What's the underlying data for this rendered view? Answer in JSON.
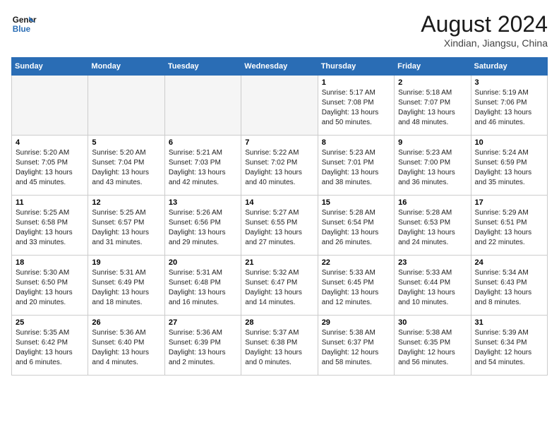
{
  "header": {
    "logo_line1": "General",
    "logo_line2": "Blue",
    "month_year": "August 2024",
    "location": "Xindian, Jiangsu, China"
  },
  "calendar": {
    "days_of_week": [
      "Sunday",
      "Monday",
      "Tuesday",
      "Wednesday",
      "Thursday",
      "Friday",
      "Saturday"
    ],
    "weeks": [
      [
        {
          "day": "",
          "empty": true
        },
        {
          "day": "",
          "empty": true
        },
        {
          "day": "",
          "empty": true
        },
        {
          "day": "",
          "empty": true
        },
        {
          "day": "1",
          "sunrise": "Sunrise: 5:17 AM",
          "sunset": "Sunset: 7:08 PM",
          "daylight": "Daylight: 13 hours and 50 minutes."
        },
        {
          "day": "2",
          "sunrise": "Sunrise: 5:18 AM",
          "sunset": "Sunset: 7:07 PM",
          "daylight": "Daylight: 13 hours and 48 minutes."
        },
        {
          "day": "3",
          "sunrise": "Sunrise: 5:19 AM",
          "sunset": "Sunset: 7:06 PM",
          "daylight": "Daylight: 13 hours and 46 minutes."
        }
      ],
      [
        {
          "day": "4",
          "sunrise": "Sunrise: 5:20 AM",
          "sunset": "Sunset: 7:05 PM",
          "daylight": "Daylight: 13 hours and 45 minutes."
        },
        {
          "day": "5",
          "sunrise": "Sunrise: 5:20 AM",
          "sunset": "Sunset: 7:04 PM",
          "daylight": "Daylight: 13 hours and 43 minutes."
        },
        {
          "day": "6",
          "sunrise": "Sunrise: 5:21 AM",
          "sunset": "Sunset: 7:03 PM",
          "daylight": "Daylight: 13 hours and 42 minutes."
        },
        {
          "day": "7",
          "sunrise": "Sunrise: 5:22 AM",
          "sunset": "Sunset: 7:02 PM",
          "daylight": "Daylight: 13 hours and 40 minutes."
        },
        {
          "day": "8",
          "sunrise": "Sunrise: 5:23 AM",
          "sunset": "Sunset: 7:01 PM",
          "daylight": "Daylight: 13 hours and 38 minutes."
        },
        {
          "day": "9",
          "sunrise": "Sunrise: 5:23 AM",
          "sunset": "Sunset: 7:00 PM",
          "daylight": "Daylight: 13 hours and 36 minutes."
        },
        {
          "day": "10",
          "sunrise": "Sunrise: 5:24 AM",
          "sunset": "Sunset: 6:59 PM",
          "daylight": "Daylight: 13 hours and 35 minutes."
        }
      ],
      [
        {
          "day": "11",
          "sunrise": "Sunrise: 5:25 AM",
          "sunset": "Sunset: 6:58 PM",
          "daylight": "Daylight: 13 hours and 33 minutes."
        },
        {
          "day": "12",
          "sunrise": "Sunrise: 5:25 AM",
          "sunset": "Sunset: 6:57 PM",
          "daylight": "Daylight: 13 hours and 31 minutes."
        },
        {
          "day": "13",
          "sunrise": "Sunrise: 5:26 AM",
          "sunset": "Sunset: 6:56 PM",
          "daylight": "Daylight: 13 hours and 29 minutes."
        },
        {
          "day": "14",
          "sunrise": "Sunrise: 5:27 AM",
          "sunset": "Sunset: 6:55 PM",
          "daylight": "Daylight: 13 hours and 27 minutes."
        },
        {
          "day": "15",
          "sunrise": "Sunrise: 5:28 AM",
          "sunset": "Sunset: 6:54 PM",
          "daylight": "Daylight: 13 hours and 26 minutes."
        },
        {
          "day": "16",
          "sunrise": "Sunrise: 5:28 AM",
          "sunset": "Sunset: 6:53 PM",
          "daylight": "Daylight: 13 hours and 24 minutes."
        },
        {
          "day": "17",
          "sunrise": "Sunrise: 5:29 AM",
          "sunset": "Sunset: 6:51 PM",
          "daylight": "Daylight: 13 hours and 22 minutes."
        }
      ],
      [
        {
          "day": "18",
          "sunrise": "Sunrise: 5:30 AM",
          "sunset": "Sunset: 6:50 PM",
          "daylight": "Daylight: 13 hours and 20 minutes."
        },
        {
          "day": "19",
          "sunrise": "Sunrise: 5:31 AM",
          "sunset": "Sunset: 6:49 PM",
          "daylight": "Daylight: 13 hours and 18 minutes."
        },
        {
          "day": "20",
          "sunrise": "Sunrise: 5:31 AM",
          "sunset": "Sunset: 6:48 PM",
          "daylight": "Daylight: 13 hours and 16 minutes."
        },
        {
          "day": "21",
          "sunrise": "Sunrise: 5:32 AM",
          "sunset": "Sunset: 6:47 PM",
          "daylight": "Daylight: 13 hours and 14 minutes."
        },
        {
          "day": "22",
          "sunrise": "Sunrise: 5:33 AM",
          "sunset": "Sunset: 6:45 PM",
          "daylight": "Daylight: 13 hours and 12 minutes."
        },
        {
          "day": "23",
          "sunrise": "Sunrise: 5:33 AM",
          "sunset": "Sunset: 6:44 PM",
          "daylight": "Daylight: 13 hours and 10 minutes."
        },
        {
          "day": "24",
          "sunrise": "Sunrise: 5:34 AM",
          "sunset": "Sunset: 6:43 PM",
          "daylight": "Daylight: 13 hours and 8 minutes."
        }
      ],
      [
        {
          "day": "25",
          "sunrise": "Sunrise: 5:35 AM",
          "sunset": "Sunset: 6:42 PM",
          "daylight": "Daylight: 13 hours and 6 minutes."
        },
        {
          "day": "26",
          "sunrise": "Sunrise: 5:36 AM",
          "sunset": "Sunset: 6:40 PM",
          "daylight": "Daylight: 13 hours and 4 minutes."
        },
        {
          "day": "27",
          "sunrise": "Sunrise: 5:36 AM",
          "sunset": "Sunset: 6:39 PM",
          "daylight": "Daylight: 13 hours and 2 minutes."
        },
        {
          "day": "28",
          "sunrise": "Sunrise: 5:37 AM",
          "sunset": "Sunset: 6:38 PM",
          "daylight": "Daylight: 13 hours and 0 minutes."
        },
        {
          "day": "29",
          "sunrise": "Sunrise: 5:38 AM",
          "sunset": "Sunset: 6:37 PM",
          "daylight": "Daylight: 12 hours and 58 minutes."
        },
        {
          "day": "30",
          "sunrise": "Sunrise: 5:38 AM",
          "sunset": "Sunset: 6:35 PM",
          "daylight": "Daylight: 12 hours and 56 minutes."
        },
        {
          "day": "31",
          "sunrise": "Sunrise: 5:39 AM",
          "sunset": "Sunset: 6:34 PM",
          "daylight": "Daylight: 12 hours and 54 minutes."
        }
      ]
    ]
  }
}
